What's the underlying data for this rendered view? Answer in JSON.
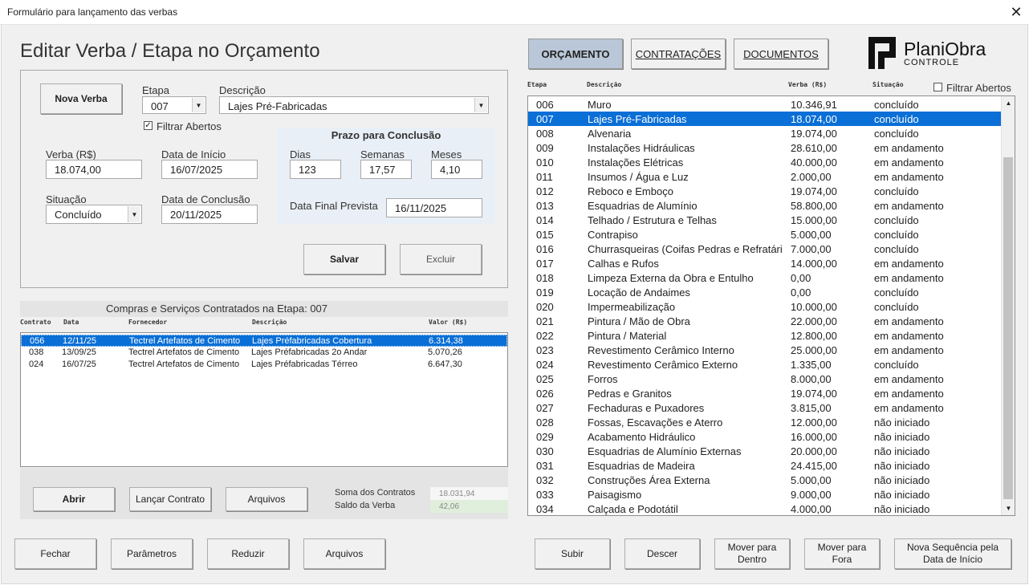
{
  "window": {
    "title": "Formulário para lançamento das verbas",
    "close_glyph": "✕"
  },
  "heading": "Editar Verba / Etapa no Orçamento",
  "edit": {
    "nova_verba_label": "Nova Verba",
    "etapa_label": "Etapa",
    "etapa_value": "007",
    "descricao_label": "Descrição",
    "descricao_value": "Lajes Pré-Fabricadas",
    "filtrar_abertos_label": "Filtrar Abertos",
    "filtrar_abertos_checked": true,
    "verba_label": "Verba (R$)",
    "verba_value": "18.074,00",
    "data_inicio_label": "Data de Início",
    "data_inicio_value": "16/07/2025",
    "situacao_label": "Situação",
    "situacao_value": "Concluído",
    "data_conclusao_label": "Data de Conclusão",
    "data_conclusao_value": "20/11/2025",
    "salvar_label": "Salvar",
    "excluir_label": "Excluir"
  },
  "prazo": {
    "title": "Prazo para Conclusão",
    "dias_label": "Dias",
    "dias_value": "123",
    "semanas_label": "Semanas",
    "semanas_value": "17,57",
    "meses_label": "Meses",
    "meses_value": "4,10",
    "data_final_label": "Data Final Prevista",
    "data_final_value": "16/11/2025"
  },
  "contratos": {
    "title": "Compras e Serviços Contratados na Etapa: 007",
    "headers": [
      "Contrato",
      "Data",
      "Fornecedor",
      "Descrição",
      "Valor (R$)"
    ],
    "rows": [
      {
        "contrato": "056",
        "data": "12/11/25",
        "fornecedor": "Tectrel Artefatos de Cimento",
        "descricao": "Lajes Préfabricadas Cobertura",
        "valor": "6.314,38",
        "selected": true
      },
      {
        "contrato": "038",
        "data": "13/09/25",
        "fornecedor": "Tectrel Artefatos de Cimento",
        "descricao": "Lajes Préfabricadas 2o Andar",
        "valor": "5.070,26",
        "selected": false
      },
      {
        "contrato": "024",
        "data": "16/07/25",
        "fornecedor": "Tectrel Artefatos de Cimento",
        "descricao": "Lajes Préfabricadas Térreo",
        "valor": "6.647,30",
        "selected": false
      }
    ],
    "abrir_label": "Abrir",
    "lancar_label": "Lançar Contrato",
    "arquivos_label": "Arquivos",
    "soma_label": "Soma dos Contratos",
    "soma_value": "18.031,94",
    "saldo_label": "Saldo da Verba",
    "saldo_value": "42,06"
  },
  "bottom_left": {
    "fechar": "Fechar",
    "parametros": "Parâmetros",
    "reduzir": "Reduzir",
    "arquivos": "Arquivos"
  },
  "tabs": {
    "orcamento": "ORÇAMENTO",
    "contratacoes": "CONTRATAÇÕES",
    "documentos": "DOCUMENTOS"
  },
  "logo": {
    "name": "PlaniObra",
    "sub": "CONTROLE"
  },
  "etapas": {
    "headers": [
      "Etapa",
      "Descrição",
      "Verba (R$)",
      "Situação"
    ],
    "filtrar_label": "Filtrar Abertos",
    "filtrar_checked": false,
    "rows": [
      [
        "006",
        "Muro",
        "10.346,91",
        "concluído"
      ],
      [
        "007",
        "Lajes Pré-Fabricadas",
        "18.074,00",
        "concluído"
      ],
      [
        "008",
        "Alvenaria",
        "19.074,00",
        "concluído"
      ],
      [
        "009",
        "Instalações Hidráulicas",
        "28.610,00",
        "em andamento"
      ],
      [
        "010",
        "Instalações Elétricas",
        "40.000,00",
        "em andamento"
      ],
      [
        "011",
        "Insumos / Água e Luz",
        "2.000,00",
        "em andamento"
      ],
      [
        "012",
        "Reboco e Emboço",
        "19.074,00",
        "concluído"
      ],
      [
        "013",
        "Esquadrias de Alumínio",
        "58.800,00",
        "em andamento"
      ],
      [
        "014",
        "Telhado / Estrutura e Telhas",
        "15.000,00",
        "concluído"
      ],
      [
        "015",
        "Contrapiso",
        "5.000,00",
        "concluído"
      ],
      [
        "016",
        "Churrasqueiras (Coifas Pedras e Refratári",
        "7.000,00",
        "concluído"
      ],
      [
        "017",
        "Calhas e Rufos",
        "14.000,00",
        "em andamento"
      ],
      [
        "018",
        "Limpeza Externa da Obra e Entulho",
        "0,00",
        "em andamento"
      ],
      [
        "019",
        "Locação de Andaimes",
        "0,00",
        "concluído"
      ],
      [
        "020",
        "Impermeabilização",
        "10.000,00",
        "concluído"
      ],
      [
        "021",
        "Pintura / Mão de Obra",
        "22.000,00",
        "em andamento"
      ],
      [
        "022",
        "Pintura / Material",
        "12.800,00",
        "em andamento"
      ],
      [
        "023",
        "Revestimento Cerâmico Interno",
        "25.000,00",
        "em andamento"
      ],
      [
        "024",
        "Revestimento Cerâmico Externo",
        "1.335,00",
        "concluído"
      ],
      [
        "025",
        "Forros",
        "8.000,00",
        "em andamento"
      ],
      [
        "026",
        "Pedras e Granitos",
        "19.074,00",
        "em andamento"
      ],
      [
        "027",
        "Fechaduras e Puxadores",
        "3.815,00",
        "em andamento"
      ],
      [
        "028",
        "Fossas, Escavações e Aterro",
        "12.000,00",
        "não iniciado"
      ],
      [
        "029",
        "Acabamento Hidráulico",
        "16.000,00",
        "não iniciado"
      ],
      [
        "030",
        "Esquadrias de Alumínio Externas",
        "20.000,00",
        "não iniciado"
      ],
      [
        "031",
        "Esquadrias de Madeira",
        "24.415,00",
        "não iniciado"
      ],
      [
        "032",
        "Construções Área Externa",
        "5.000,00",
        "não iniciado"
      ],
      [
        "033",
        "Paisagismo",
        "9.000,00",
        "não iniciado"
      ],
      [
        "034",
        "Calçada e Podotátil",
        "4.000,00",
        "não iniciado"
      ]
    ],
    "selected_etapa": "007"
  },
  "bottom_right": {
    "subir": "Subir",
    "descer": "Descer",
    "mover_dentro": [
      "Mover para",
      "Dentro"
    ],
    "mover_fora": [
      "Mover para",
      "Fora"
    ],
    "nova_sequencia": [
      "Nova Sequência pela",
      "Data de Início"
    ]
  },
  "colors": {
    "selection": "#0a6fd6",
    "active_tab": "#b9c7d8",
    "prazo_bg": "#e9eff6"
  }
}
